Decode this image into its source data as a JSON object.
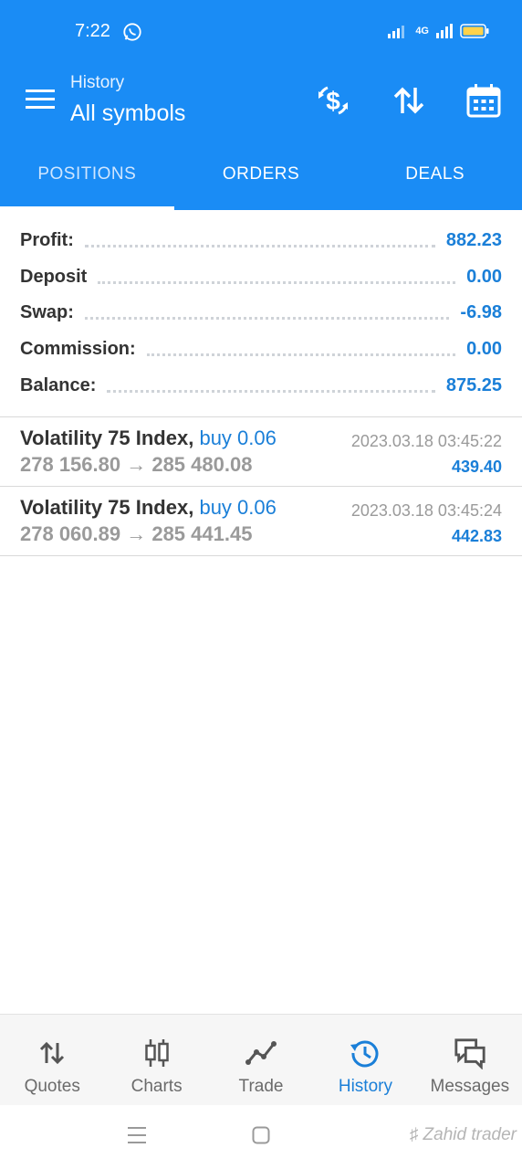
{
  "status": {
    "time": "7:22",
    "network": "4G"
  },
  "appbar": {
    "subtitle": "History",
    "title": "All symbols"
  },
  "tabs": [
    {
      "label": "POSITIONS",
      "active": true
    },
    {
      "label": "ORDERS",
      "active": false
    },
    {
      "label": "DEALS",
      "active": false
    }
  ],
  "summary": [
    {
      "label": "Profit:",
      "value": "882.23"
    },
    {
      "label": "Deposit",
      "value": "0.00"
    },
    {
      "label": "Swap:",
      "value": "-6.98"
    },
    {
      "label": "Commission:",
      "value": "0.00"
    },
    {
      "label": "Balance:",
      "value": "875.25"
    }
  ],
  "deals": [
    {
      "symbol": "Volatility 75 Index,",
      "type": "buy 0.06",
      "prices": "278 156.80 → 285 480.08",
      "time": "2023.03.18 03:45:22",
      "profit": "439.40"
    },
    {
      "symbol": "Volatility 75 Index,",
      "type": "buy 0.06",
      "prices": "278 060.89 → 285 441.45",
      "time": "2023.03.18 03:45:24",
      "profit": "442.83"
    }
  ],
  "bottom_nav": [
    {
      "label": "Quotes",
      "icon": "arrows-up-down-icon",
      "active": false
    },
    {
      "label": "Charts",
      "icon": "candlestick-icon",
      "active": false
    },
    {
      "label": "Trade",
      "icon": "trend-line-icon",
      "active": false
    },
    {
      "label": "History",
      "icon": "history-clock-icon",
      "active": true
    },
    {
      "label": "Messages",
      "icon": "chat-bubbles-icon",
      "active": false
    }
  ],
  "watermark": "Zahid trader",
  "colors": {
    "primary": "#1a8cf5",
    "accent_text": "#1a7fd8",
    "muted_text": "#9a9a9a"
  }
}
